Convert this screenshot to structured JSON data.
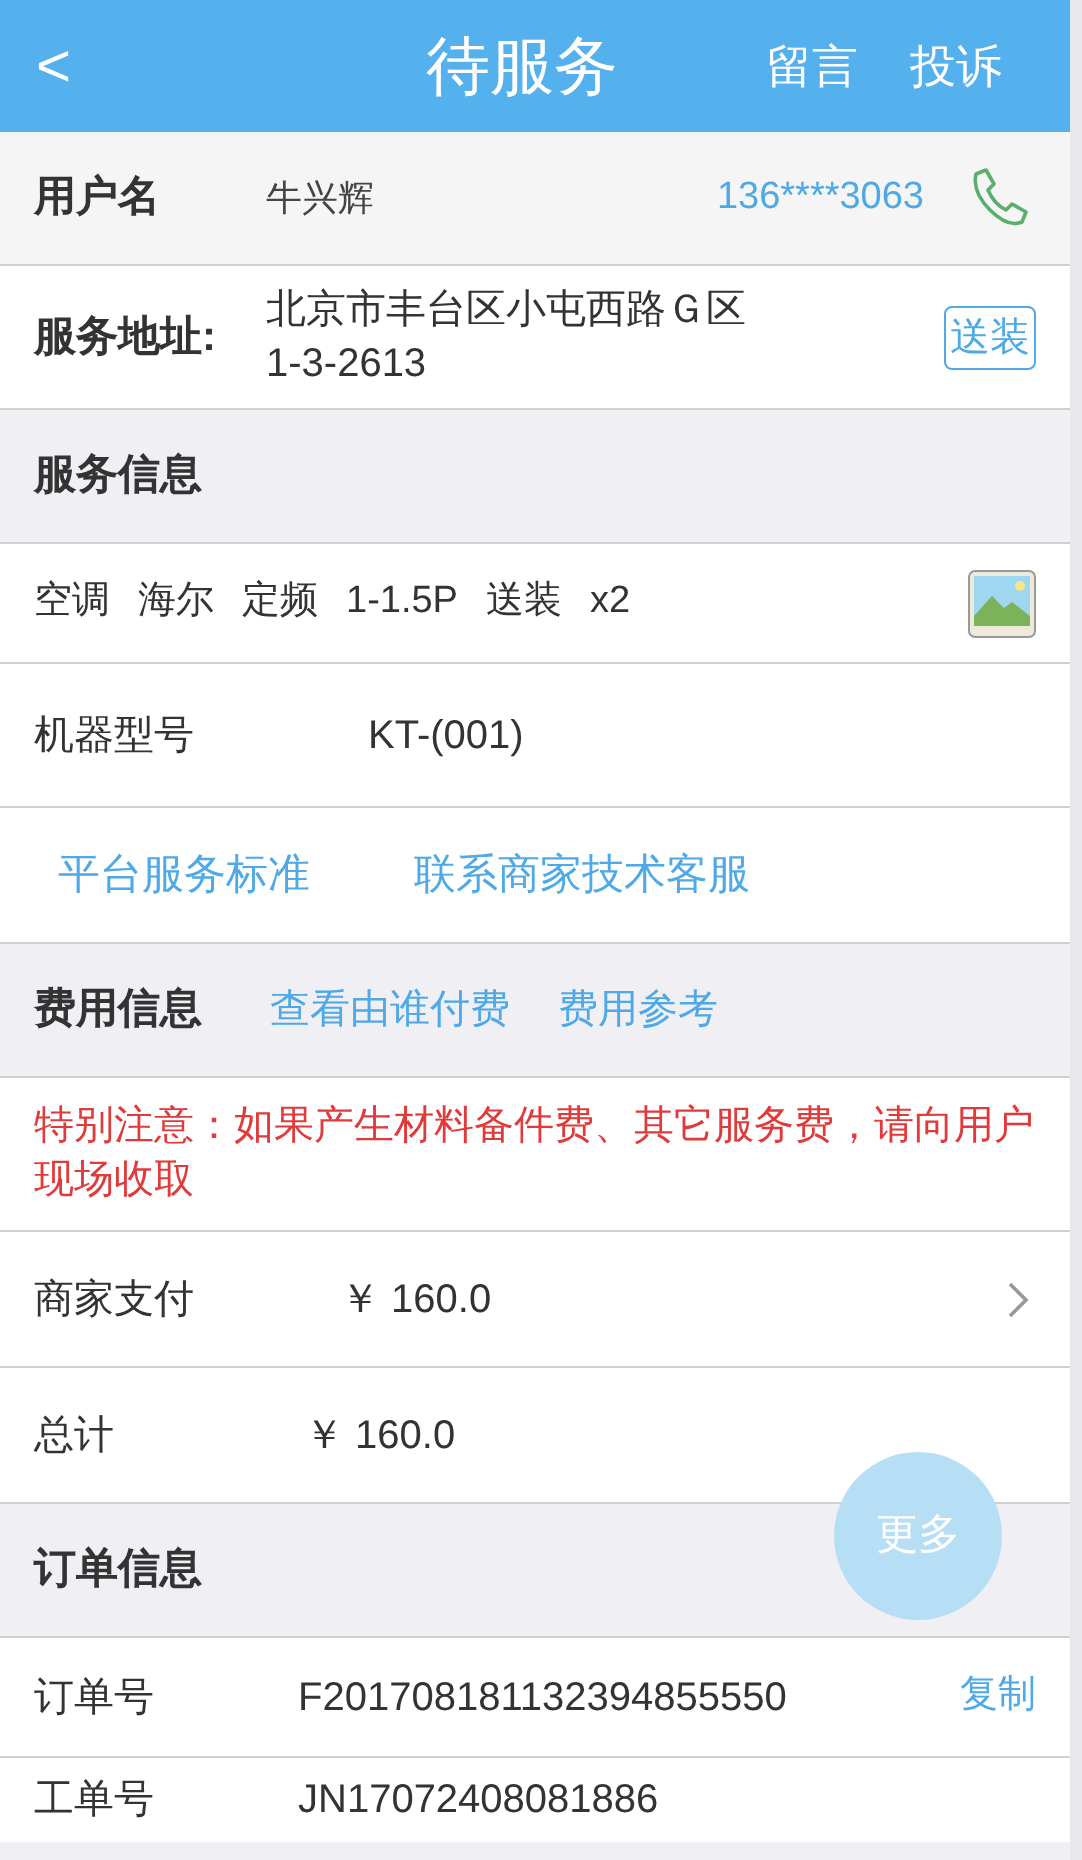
{
  "header": {
    "back": "<",
    "title": "待服务",
    "actions": [
      "留言",
      "投诉"
    ]
  },
  "customer": {
    "label": "用户名",
    "name": "牛兴辉",
    "phone": "136****3063"
  },
  "address": {
    "label": "服务地址:",
    "lines": [
      "北京市丰台区小屯西路Ｇ区",
      "1-3-2613"
    ],
    "tag": "送装"
  },
  "service": {
    "heading": "服务信息",
    "product": [
      "空调",
      "海尔",
      "定频",
      "1-1.5P",
      "送装",
      "x2"
    ],
    "model_label": "机器型号",
    "model": "KT-(001)",
    "links": [
      "平台服务标准",
      "联系商家技术客服"
    ]
  },
  "fees": {
    "heading": "费用信息",
    "links": [
      "查看由谁付费",
      "费用参考"
    ],
    "notice": "特别注意：如果产生材料备件费、其它服务费，请向用户现场收取",
    "rows": [
      {
        "label": "商家支付",
        "value": "￥ 160.0",
        "kind": "link"
      },
      {
        "label": "总计",
        "value": "￥ 160.0",
        "kind": "plain"
      }
    ]
  },
  "more_button": "更多",
  "order": {
    "heading": "订单信息",
    "rows": [
      {
        "label": "订单号",
        "value": "F201708181132394855550",
        "action": "复制"
      },
      {
        "label": "工单号",
        "value": "JN17072408081886"
      }
    ]
  }
}
